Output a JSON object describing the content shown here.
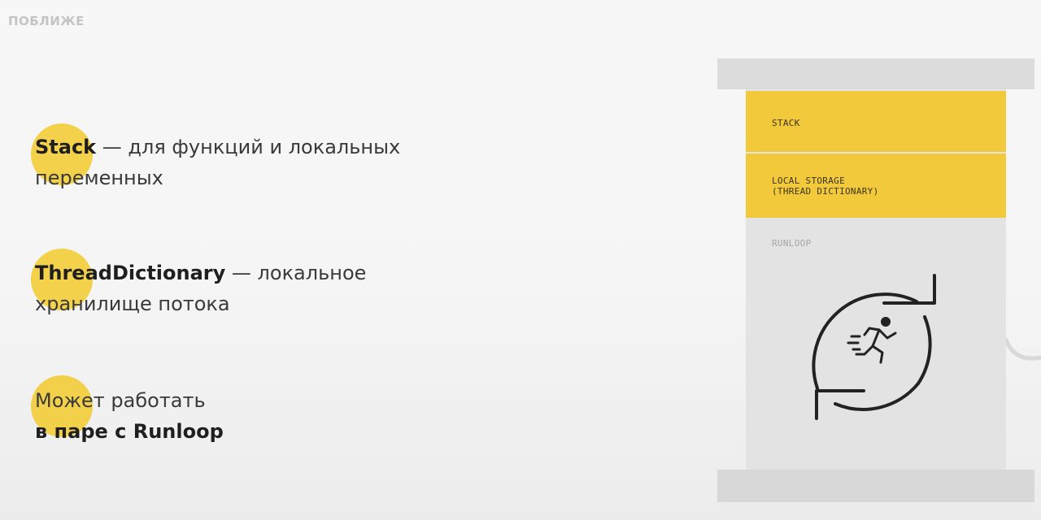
{
  "slide": {
    "section_label": "ПОБЛИЖЕ"
  },
  "bullets": [
    {
      "bold": "Stack",
      "rest_line1": " — для функций и локальных",
      "line2": "переменных"
    },
    {
      "bold": "ThreadDictionary",
      "rest_line1": " — локальное",
      "line2": "хранилище потока"
    },
    {
      "line1": "Может работать",
      "bold_line2": "в паре с Runloop"
    }
  ],
  "diagram": {
    "stack_label": "STACK",
    "local_storage_line1": "LOCAL STORAGE",
    "local_storage_line2": "(THREAD DICTIONARY)",
    "runloop_label": "RUNLOOP",
    "runloop_icon": "cycle-arrows-with-running-person-icon"
  },
  "colors": {
    "accent_yellow": "#f1c93b",
    "column_gray": "#e3e3e3",
    "cap_gray": "#dcdcdc",
    "muted_text": "#c4c4c4"
  }
}
